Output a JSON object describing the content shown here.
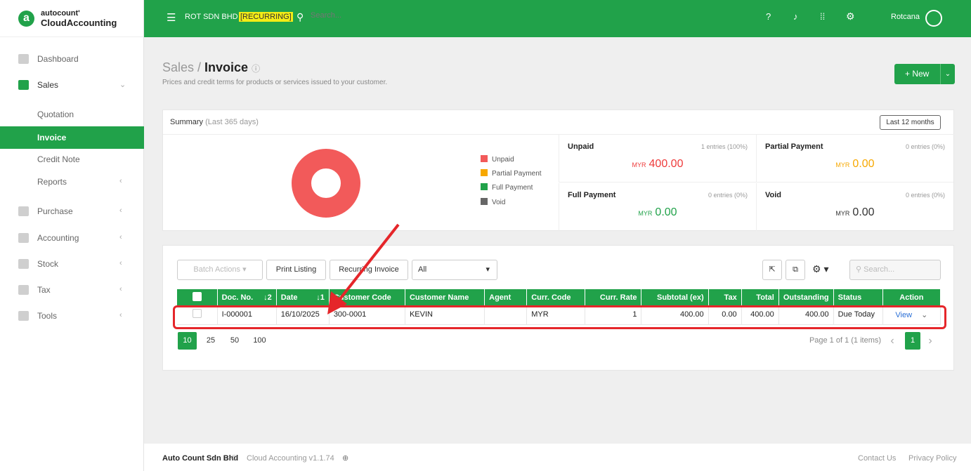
{
  "brand": {
    "line1": "autocount'",
    "line2": "CloudAccounting",
    "logo_letter": "a"
  },
  "sidebar": {
    "items": [
      {
        "label": "Dashboard"
      },
      {
        "label": "Sales"
      },
      {
        "label": "Quotation"
      },
      {
        "label": "Invoice"
      },
      {
        "label": "Credit Note"
      },
      {
        "label": "Reports"
      },
      {
        "label": "Purchase"
      },
      {
        "label": "Accounting"
      },
      {
        "label": "Stock"
      },
      {
        "label": "Tax"
      },
      {
        "label": "Tools"
      }
    ]
  },
  "topbar": {
    "company": "ROT SDN BHD",
    "recurring": "[RECURRING]",
    "search_placeholder": "Search...",
    "user": "Rotcana"
  },
  "page": {
    "breadcrumb": "Sales /",
    "title": "Invoice",
    "subtitle": "Prices and credit terms for products or services issued to your customer.",
    "new_label": "+ New"
  },
  "summary": {
    "label": "Summary",
    "period": "(Last 365 days)",
    "range_button": "Last 12 months",
    "legend": [
      {
        "label": "Unpaid",
        "color": "#f25a5a"
      },
      {
        "label": "Partial Payment",
        "color": "#f7a800"
      },
      {
        "label": "Full Payment",
        "color": "#21a24a"
      },
      {
        "label": "Void",
        "color": "#666666"
      }
    ],
    "stats": [
      {
        "name": "Unpaid",
        "entries": "1 entries (100%)",
        "currency": "MYR",
        "value": "400.00",
        "color": "#ee3b3b"
      },
      {
        "name": "Partial Payment",
        "entries": "0 entries (0%)",
        "currency": "MYR",
        "value": "0.00",
        "color": "#f7a800"
      },
      {
        "name": "Full Payment",
        "entries": "0 entries (0%)",
        "currency": "MYR",
        "value": "0.00",
        "color": "#21a24a"
      },
      {
        "name": "Void",
        "entries": "0 entries (0%)",
        "currency": "MYR",
        "value": "0.00",
        "color": "#333333"
      }
    ]
  },
  "toolbar": {
    "batch": "Batch Actions",
    "print": "Print Listing",
    "recurring": "Recurring Invoice",
    "filter": "All",
    "search_placeholder": "Search..."
  },
  "table": {
    "headers": [
      "Doc. No.",
      "Date",
      "Customer Code",
      "Customer Name",
      "Agent",
      "Curr. Code",
      "Curr. Rate",
      "Subtotal (ex)",
      "Tax",
      "Total",
      "Outstanding",
      "Status",
      "Action"
    ],
    "sort_doc": "↓2",
    "sort_date": "↓1",
    "rows": [
      {
        "doc": "I-000001",
        "date": "16/10/2025",
        "code": "300-0001",
        "name": "KEVIN",
        "agent": "",
        "curr": "MYR",
        "rate": "1",
        "subtotal": "400.00",
        "tax": "0.00",
        "total": "400.00",
        "outstanding": "400.00",
        "status": "Due Today",
        "action": "View"
      }
    ]
  },
  "pagination": {
    "sizes": [
      "10",
      "25",
      "50",
      "100"
    ],
    "info": "Page 1 of 1 (1 items)",
    "current": "1"
  },
  "footer": {
    "company": "Auto Count Sdn Bhd",
    "copy": "©",
    "version": "Cloud Accounting v1.1.74",
    "contact": "Contact Us",
    "privacy": "Privacy Policy"
  }
}
